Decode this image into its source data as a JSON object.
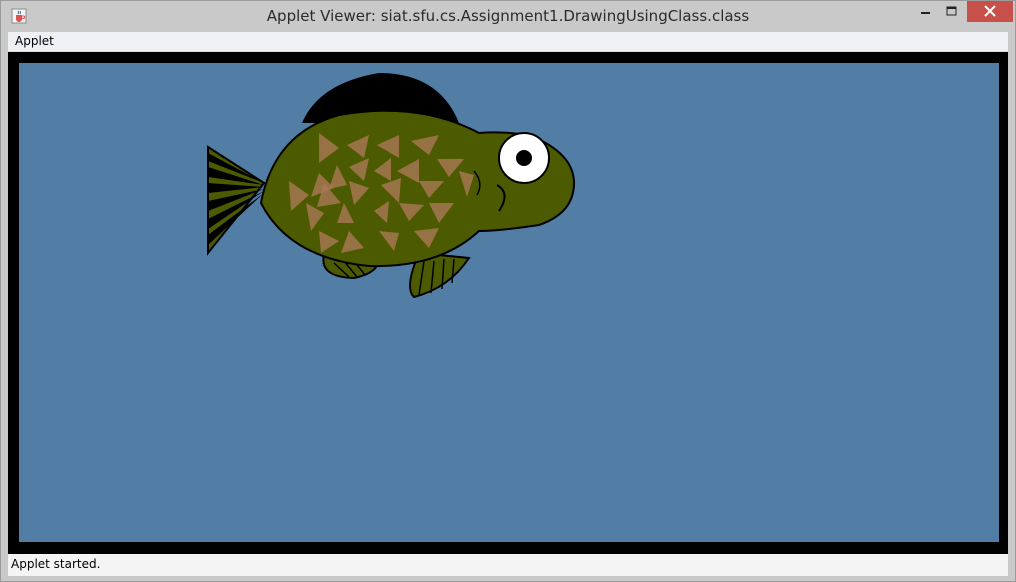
{
  "window": {
    "title": "Applet Viewer: siat.sfu.cs.Assignment1.DrawingUsingClass.class"
  },
  "menubar": {
    "items": [
      {
        "label": "Applet"
      }
    ]
  },
  "status": {
    "text": "Applet started."
  },
  "colors": {
    "canvas_background": "#527ea6",
    "fish_body": "#4c5b00",
    "fish_scales": "#b07a5c",
    "fin_dark": "#000000"
  },
  "icons": {
    "app": "java-cup-icon",
    "minimize": "minimize-icon",
    "maximize": "maximize-icon",
    "close": "close-icon"
  }
}
